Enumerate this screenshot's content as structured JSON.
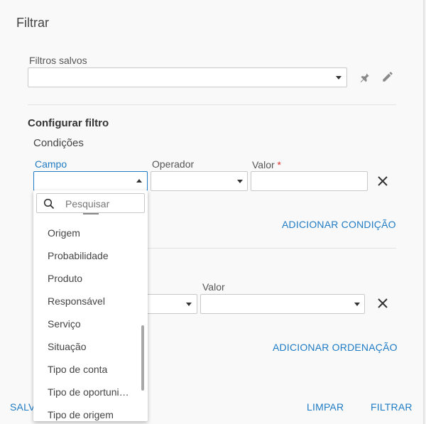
{
  "dialog": {
    "title": "Filtrar"
  },
  "saved_filters": {
    "label": "Filtros salvos",
    "value": ""
  },
  "configure": {
    "title": "Configurar filtro",
    "conditions_title": "Condições"
  },
  "condition": {
    "campo_label": "Campo",
    "operador_label": "Operador",
    "valor_label": "Valor",
    "required_mark": "*",
    "add_label": "ADICIONAR CONDIÇÃO"
  },
  "sort": {
    "valor_label": "Valor",
    "add_label": "ADICIONAR ORDENAÇÃO"
  },
  "dropdown": {
    "search_placeholder": "Pesquisar",
    "options": [
      "Origem",
      "Probabilidade",
      "Produto",
      "Responsável",
      "Serviço",
      "Situação",
      "Tipo de conta",
      "Tipo de oportuni…",
      "Tipo de origem"
    ]
  },
  "footer": {
    "save_label": "SALV",
    "clear_label": "LIMPAR",
    "filter_label": "FILTRAR"
  },
  "colors": {
    "accent": "#1e7bc4",
    "required": "#d9342b"
  },
  "icons": {
    "pin": "pin-icon",
    "edit": "pencil-icon",
    "close": "close-icon",
    "search": "search-icon"
  }
}
